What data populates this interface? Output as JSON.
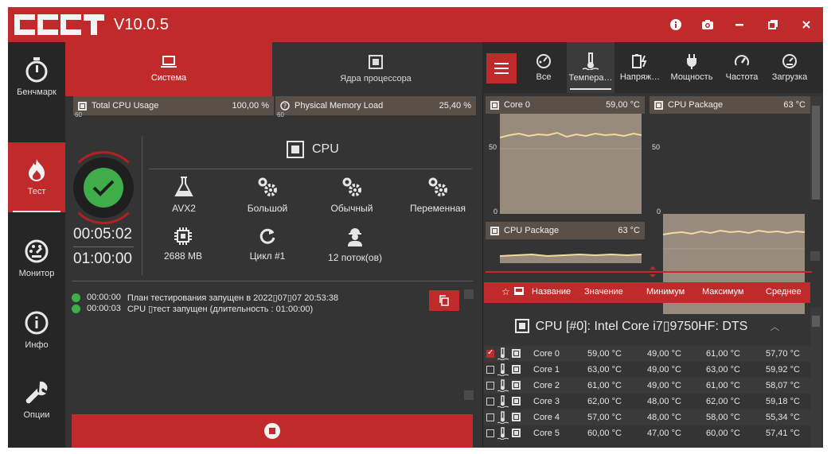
{
  "app": {
    "version": "V10.0.5"
  },
  "titlebar": {
    "buttons": [
      "info-icon",
      "camera-icon",
      "minimize-icon",
      "restore-icon",
      "close-icon"
    ]
  },
  "leftnav": {
    "items": [
      {
        "label": "Бенчмарк",
        "icon": "stopwatch-icon"
      },
      {
        "label": "Тест",
        "icon": "flame-icon",
        "active": true
      },
      {
        "label": "Монитор",
        "icon": "gauge-icon"
      },
      {
        "label": "Инфо",
        "icon": "info-icon"
      },
      {
        "label": "Опции",
        "icon": "wrench-icon"
      }
    ]
  },
  "tabs": [
    {
      "label": "Система",
      "icon": "laptop-icon",
      "active": true
    },
    {
      "label": "Ядра процессора",
      "icon": "cpu-icon"
    }
  ],
  "graphs": {
    "cpu_usage": {
      "label": "Total CPU Usage",
      "value": "100,00 %",
      "tick": "60"
    },
    "memory": {
      "label": "Physical Memory Load",
      "value": "25,40 %",
      "tick": "60"
    }
  },
  "test": {
    "name": "CPU",
    "elapsed": "00:05:02",
    "duration": "01:00:00",
    "options": [
      {
        "label": "AVX2",
        "icon": "flask-icon"
      },
      {
        "label": "Большой",
        "icon": "gears-icon"
      },
      {
        "label": "Обычный",
        "icon": "gears-icon"
      },
      {
        "label": "Переменная",
        "icon": "gears-icon"
      },
      {
        "label": "2688 MB",
        "icon": "chip-icon"
      },
      {
        "label": "Цикл #1",
        "icon": "refresh-icon"
      },
      {
        "label": "12 поток(ов)",
        "icon": "worker-icon"
      }
    ]
  },
  "log": [
    {
      "time": "00:00:00",
      "text": "План тестирования запущен в 2022▯07▯07 20:53:38"
    },
    {
      "time": "00:00:03",
      "text": "CPU ▯тест запущен (длительность : 01:00:00)"
    }
  ],
  "rightTabs": [
    {
      "label": "Все",
      "icon": "all-icon"
    },
    {
      "label": "Темпера…",
      "icon": "thermometer-icon",
      "active": true
    },
    {
      "label": "Напряж…",
      "icon": "voltage-icon"
    },
    {
      "label": "Мощность",
      "icon": "plug-icon"
    },
    {
      "label": "Частота",
      "icon": "speedometer-icon"
    },
    {
      "label": "Загрузка",
      "icon": "load-icon"
    }
  ],
  "charts": [
    {
      "title": "Core 0",
      "value": "59,00 °C",
      "ticks": [
        "50",
        "0"
      ]
    },
    {
      "title": "CPU Package",
      "value": "63 °C",
      "ticks": [
        "50",
        "0"
      ]
    },
    {
      "title": "CPU Package",
      "value": "63 °C",
      "ticks": []
    }
  ],
  "sensorTable": {
    "headers": [
      "Название",
      "Значение",
      "Минимум",
      "Максимум",
      "Среднее"
    ],
    "device": "CPU [#0]: Intel Core i7▯9750HF: DTS",
    "rows": [
      {
        "name": "Core 0",
        "value": "59,00 °C",
        "min": "49,00 °C",
        "max": "61,00 °C",
        "avg": "57,70 °C",
        "checked": true
      },
      {
        "name": "Core 1",
        "value": "63,00 °C",
        "min": "49,00 °C",
        "max": "63,00 °C",
        "avg": "59,92 °C",
        "checked": false
      },
      {
        "name": "Core 2",
        "value": "61,00 °C",
        "min": "49,00 °C",
        "max": "61,00 °C",
        "avg": "58,07 °C",
        "checked": false
      },
      {
        "name": "Core 3",
        "value": "62,00 °C",
        "min": "48,00 °C",
        "max": "62,00 °C",
        "avg": "59,18 °C",
        "checked": false
      },
      {
        "name": "Core 4",
        "value": "57,00 °C",
        "min": "48,00 °C",
        "max": "58,00 °C",
        "avg": "55,34 °C",
        "checked": false
      },
      {
        "name": "Core 5",
        "value": "60,00 °C",
        "min": "47,00 °C",
        "max": "60,00 °C",
        "avg": "57,41 °C",
        "checked": false
      }
    ]
  },
  "colors": {
    "accent": "#c02a2a",
    "ok": "#3fae49",
    "panel": "#343434",
    "nav": "#262626",
    "chart": "#978b7d",
    "chartline": "#f3d9a0"
  }
}
